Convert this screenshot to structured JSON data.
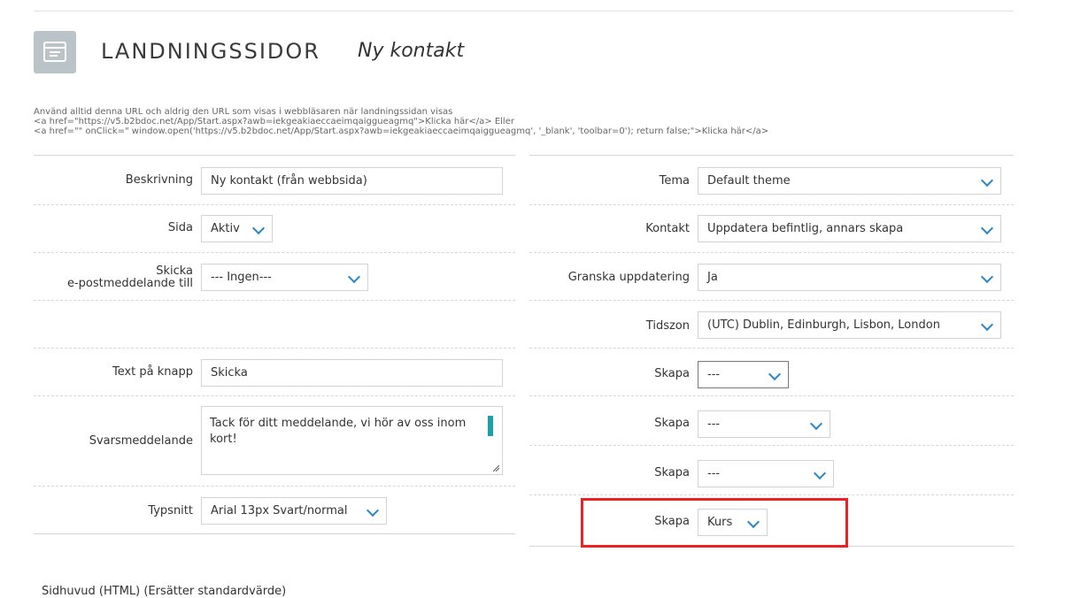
{
  "header": {
    "icon": "window-form-icon",
    "title": "LANDNINGSSIDOR",
    "subtitle": "Ny kontakt"
  },
  "info": {
    "line1": "Använd alltid denna URL och aldrig den URL som visas i webbläsaren när landningssidan visas",
    "line2": "<a href=\"https://v5.b2bdoc.net/App/Start.aspx?awb=iekgeakiaeccaeimqaiggueagmq\">Klicka här</a>       Eller",
    "line3": "<a href=\"\" onClick=\" window.open('https://v5.b2bdoc.net/App/Start.aspx?awb=iekgeakiaeccaeimqaiggueagmq', '_blank', 'toolbar=0'); return false;\">Klicka här</a>"
  },
  "left": {
    "beskrivning": {
      "label": "Beskrivning",
      "value": "Ny kontakt (från webbsida)"
    },
    "sida": {
      "label": "Sida",
      "value": "Aktiv"
    },
    "skicka": {
      "label_line1": "Skicka",
      "label_line2": "e-postmeddelande till",
      "value": "--- Ingen---"
    },
    "text_pa_knapp": {
      "label": "Text på knapp",
      "value": "Skicka"
    },
    "svarsmeddelande": {
      "label": "Svarsmeddelande",
      "value": "Tack för ditt meddelande, vi hör av oss inom kort!"
    },
    "typsnitt": {
      "label": "Typsnitt",
      "value": "Arial 13px Svart/normal"
    }
  },
  "right": {
    "tema": {
      "label": "Tema",
      "value": "Default theme"
    },
    "kontakt": {
      "label": "Kontakt",
      "value": "Uppdatera befintlig, annars skapa"
    },
    "granska": {
      "label": "Granska uppdatering",
      "value": "Ja"
    },
    "tidszon": {
      "label": "Tidszon",
      "value": "(UTC) Dublin, Edinburgh, Lisbon, London"
    },
    "skapa1": {
      "label": "Skapa",
      "value": "---"
    },
    "skapa2": {
      "label": "Skapa",
      "value": "---"
    },
    "skapa3": {
      "label": "Skapa",
      "value": "---"
    },
    "skapa4": {
      "label": "Skapa",
      "value": "Kurs"
    }
  },
  "footer": {
    "label": "Sidhuvud (HTML) (Ersätter standardvärde)"
  },
  "colors": {
    "accent": "#2b87c7",
    "highlight": "#ee2222",
    "teal": "#19a3a8"
  }
}
